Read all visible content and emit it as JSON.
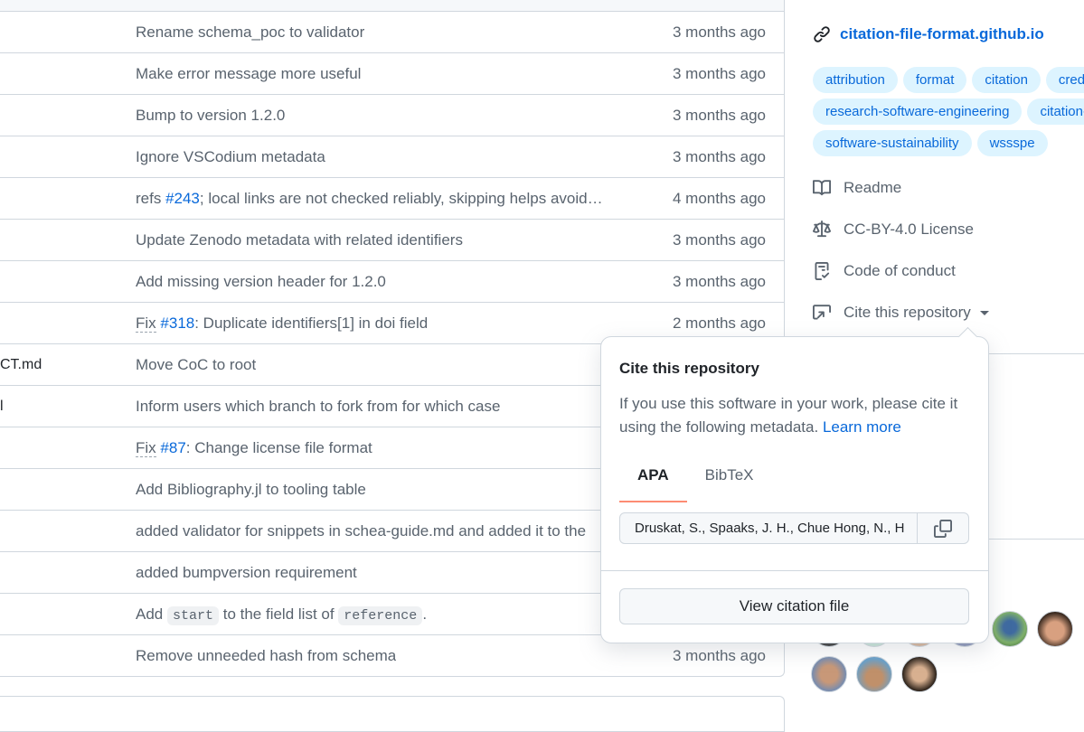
{
  "files": [
    {
      "name": "",
      "message": "Rename schema_poc to validator",
      "time": "3 months ago"
    },
    {
      "name": "",
      "message": "Make error message more useful",
      "time": "3 months ago"
    },
    {
      "name": "",
      "message": "Bump to version 1.2.0",
      "time": "3 months ago"
    },
    {
      "name": "",
      "message": "Ignore VSCodium metadata",
      "time": "3 months ago"
    },
    {
      "name": "",
      "msg_prefix": "refs ",
      "msg_link": "#243",
      "msg_suffix": "; local links are not checked reliably, skipping helps avoid…",
      "time": "4 months ago"
    },
    {
      "name": "",
      "message": "Update Zenodo metadata with related identifiers",
      "time": "3 months ago"
    },
    {
      "name": "",
      "message": "Add missing version header for 1.2.0",
      "time": "3 months ago"
    },
    {
      "name": "",
      "msg_prefix": "Fix",
      "msg_link": "#318",
      "msg_suffix": ": Duplicate identifiers[1] in doi field",
      "time": "2 months ago"
    },
    {
      "name": "CT.md",
      "message": "Move CoC to root",
      "time": ""
    },
    {
      "name": "l",
      "message": "Inform users which branch to fork from for which case",
      "time": ""
    },
    {
      "name": "",
      "msg_prefix": "Fix",
      "msg_link": "#87",
      "msg_suffix": ": Change license file format",
      "time": ""
    },
    {
      "name": "",
      "message": "Add Bibliography.jl to tooling table",
      "time": ""
    },
    {
      "name": "",
      "message": "added validator for snippets in schea-guide.md and added it to the",
      "time": ""
    },
    {
      "name": "",
      "message": "added bumpversion requirement",
      "time": ""
    },
    {
      "name": "",
      "msg_code": [
        "Add ",
        "start",
        " to the field list of ",
        "reference",
        "."
      ],
      "time": ""
    },
    {
      "name": "",
      "message": "Remove unneeded hash from schema",
      "time": "3 months ago"
    }
  ],
  "sidebar": {
    "homepage": "citation-file-format.github.io",
    "topics": [
      "attribution",
      "format",
      "citation",
      "cred",
      "research-software-engineering",
      "citation-",
      "software-sustainability",
      "wssspe"
    ],
    "readme": "Readme",
    "license": "CC-BY-4.0 License",
    "conduct": "Code of conduct",
    "cite": "Cite this repository"
  },
  "popover": {
    "title": "Cite this repository",
    "desc": "If you use this software in your work, please cite it using the following metadata.",
    "learn_more": "Learn more",
    "tabs": [
      "APA",
      "BibTeX"
    ],
    "citation": "Druskat, S., Spaaks, J. H., Chue Hong, N., H",
    "view_button": "View citation file"
  },
  "colors": {
    "accent": "#0969da",
    "tab_underline": "#fd8c73",
    "topic_bg": "#ddf4ff"
  },
  "icons": [
    "link-icon",
    "book-icon",
    "law-icon",
    "code-of-conduct-icon",
    "cite-icon",
    "copy-icon",
    "caret-down-icon"
  ]
}
